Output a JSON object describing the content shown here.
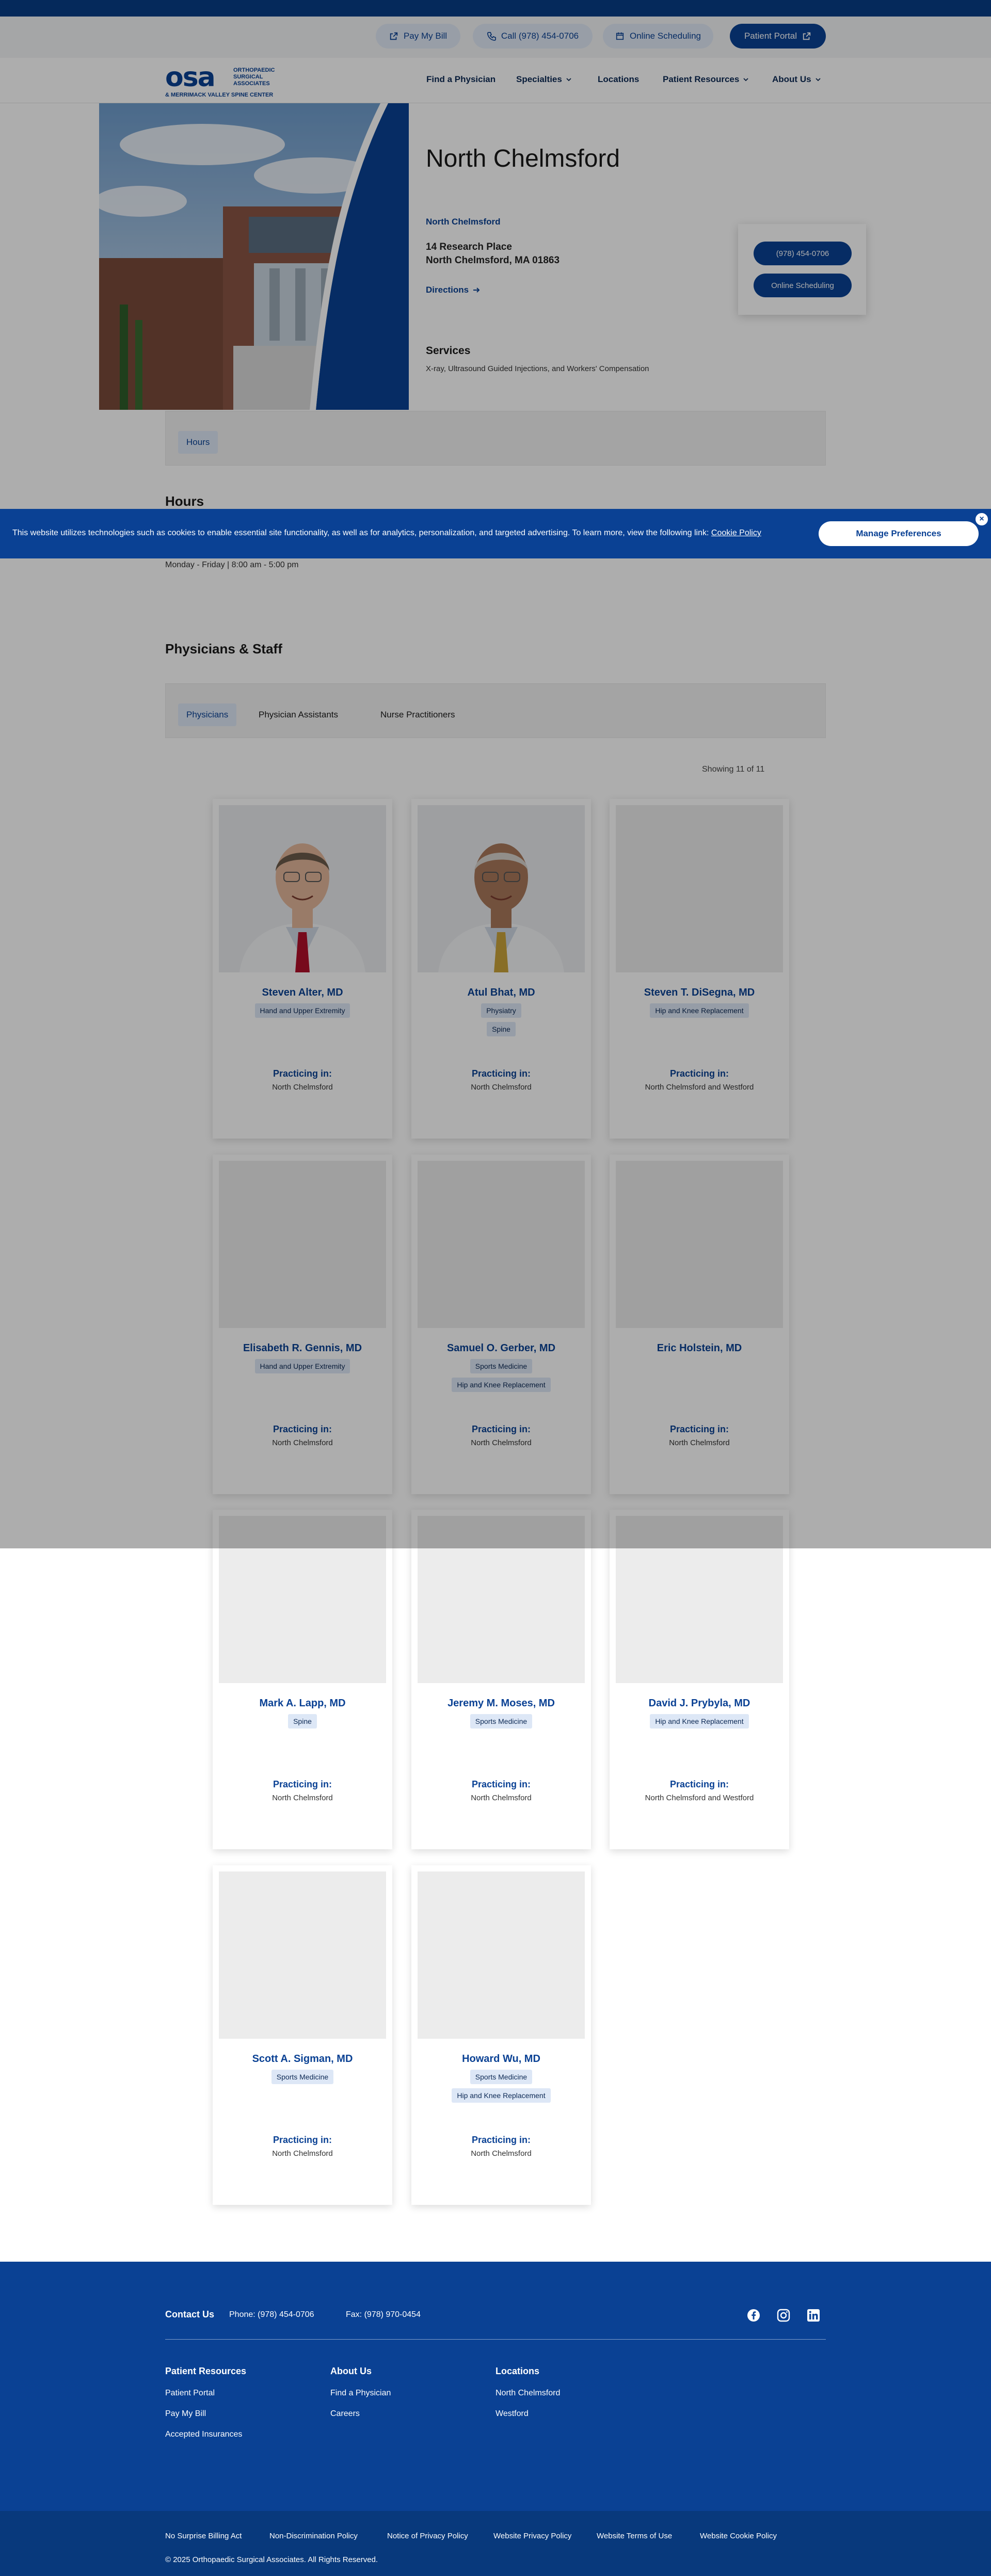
{
  "utility": {
    "pay_bill": "Pay My Bill",
    "call": "Call (978) 454-0706",
    "online_scheduling": "Online Scheduling",
    "patient_portal": "Patient Portal"
  },
  "logo": {
    "main": "osa",
    "sub": "Orthopaedic Surgical Associates",
    "tag": "& Merrimack Valley Spine Center"
  },
  "nav": {
    "items": [
      "Find a Physician",
      "Specialties",
      "Locations",
      "Patient Resources",
      "About Us"
    ]
  },
  "location": {
    "title": "North Chelmsford",
    "link": "North Chelmsford",
    "address_line1": "14 Research Place",
    "address_line2": "North Chelmsford, MA 01863",
    "directions": "Directions",
    "services_heading": "Services",
    "services_text": "X-ray, Ultrasound Guided Injections, and Workers' Compensation",
    "phone_button": "(978) 454-0706",
    "schedule_button": "Online Scheduling"
  },
  "hours": {
    "tab": "Hours",
    "heading": "Hours",
    "line": "Monday - Friday | 8:00 am - 5:00 pm"
  },
  "cookie": {
    "text": "This website utilizes technologies such as cookies to enable essential site functionality, as well as for analytics, personalization, and targeted advertising. To learn more, view the following link:",
    "link": "Cookie Policy",
    "button": "Manage Preferences",
    "close": "×"
  },
  "staff": {
    "heading": "Physicians & Staff",
    "tabs": [
      "Physicians",
      "Physician Assistants",
      "Nurse Practitioners"
    ],
    "showing": "Showing 11 of 11",
    "practicing_label": "Practicing in:",
    "physicians": [
      {
        "name": "Steven Alter, MD",
        "tags": [
          "Hand and Upper Extremity"
        ],
        "location": "North Chelmsford"
      },
      {
        "name": "Atul Bhat, MD",
        "tags": [
          "Physiatry",
          "Spine"
        ],
        "location": "North Chelmsford"
      },
      {
        "name": "Steven T. DiSegna, MD",
        "tags": [
          "Hip and Knee Replacement"
        ],
        "location": "North Chelmsford and Westford"
      },
      {
        "name": "Elisabeth R. Gennis, MD",
        "tags": [
          "Hand and Upper Extremity"
        ],
        "location": "North Chelmsford"
      },
      {
        "name": "Samuel O. Gerber, MD",
        "tags": [
          "Sports Medicine",
          "Hip and Knee Replacement"
        ],
        "location": "North Chelmsford"
      },
      {
        "name": "Eric Holstein, MD",
        "tags": [],
        "location": "North Chelmsford"
      },
      {
        "name": "Mark A. Lapp, MD",
        "tags": [
          "Spine"
        ],
        "location": "North Chelmsford"
      },
      {
        "name": "Jeremy M. Moses, MD",
        "tags": [
          "Sports Medicine"
        ],
        "location": "North Chelmsford"
      },
      {
        "name": "David J. Prybyla, MD",
        "tags": [
          "Hip and Knee Replacement"
        ],
        "location": "North Chelmsford and Westford"
      },
      {
        "name": "Scott A. Sigman, MD",
        "tags": [
          "Sports Medicine"
        ],
        "location": "North Chelmsford"
      },
      {
        "name": "Howard Wu, MD",
        "tags": [
          "Sports Medicine",
          "Hip and Knee Replacement"
        ],
        "location": "North Chelmsford"
      }
    ]
  },
  "footer": {
    "contact_heading": "Contact Us",
    "phone": "Phone: (978) 454-0706",
    "fax": "Fax: (978) 970-0454",
    "patient_resources_heading": "Patient Resources",
    "patient_resources": [
      "Patient Portal",
      "Pay My Bill",
      "Accepted Insurances"
    ],
    "about_heading": "About Us",
    "about": [
      "Find a Physician",
      "Careers"
    ],
    "locations_heading": "Locations",
    "locations": [
      "North Chelmsford",
      "Westford"
    ],
    "legal": [
      "No Surprise Billing Act",
      "Non-Discrimination Policy",
      "Notice of Privacy Policy",
      "Website Privacy Policy",
      "Website Terms of Use",
      "Website Cookie Policy"
    ],
    "copyright": "© 2025 Orthopaedic Surgical Associates. All Rights Reserved."
  },
  "colors": {
    "brand_blue": "#0a4194",
    "tag_bg": "#dde7f6"
  }
}
